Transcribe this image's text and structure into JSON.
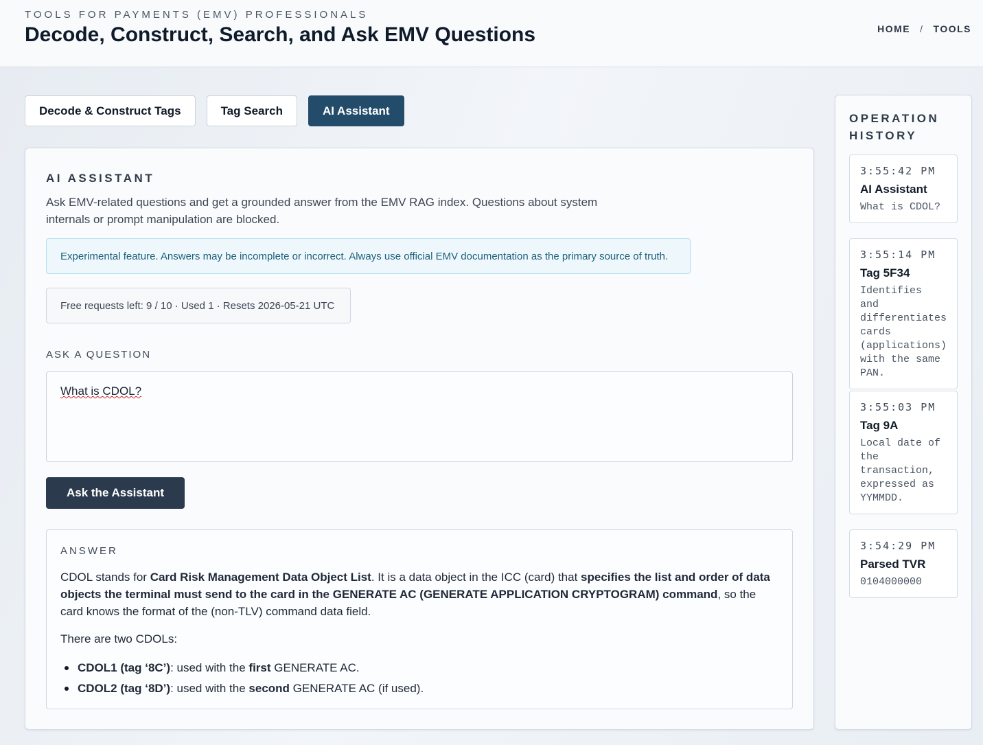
{
  "header": {
    "eyebrow": "TOOLS FOR PAYMENTS (EMV) PROFESSIONALS",
    "title": "Decode, Construct, Search, and Ask EMV Questions",
    "nav": [
      {
        "label": "HOME"
      },
      {
        "label": "TOOLS"
      }
    ],
    "nav_separator": "/"
  },
  "tabs": [
    {
      "label": "Decode & Construct Tags",
      "active": false
    },
    {
      "label": "Tag Search",
      "active": false
    },
    {
      "label": "AI Assistant",
      "active": true
    }
  ],
  "assistant": {
    "section_title": "AI ASSISTANT",
    "description": "Ask EMV-related questions and get a grounded answer from the EMV RAG index. Questions about system internals or prompt manipulation are blocked.",
    "notice": "Experimental feature. Answers may be incomplete or incorrect. Always use official EMV documentation as the primary source of truth.",
    "quota": "Free requests left: 9 / 10 · Used 1 · Resets 2026-05-21 UTC",
    "question_label": "ASK A QUESTION",
    "question_value": "What is CDOL?",
    "ask_button": "Ask the Assistant",
    "answer_label": "ANSWER",
    "answer": {
      "p1_a": "CDOL stands for ",
      "p1_b": "Card Risk Management Data Object List",
      "p1_c": ". It is a data object in the ICC (card) that ",
      "p1_d": "specifies the list and order of data objects the terminal must send to the card in the GENERATE AC (GENERATE APPLICATION CRYPTOGRAM) command",
      "p1_e": ", so the card knows the format of the (non-TLV) command data field.",
      "p2": "There are two CDOLs:",
      "items": [
        {
          "term": "CDOL1 (tag ‘8C’)",
          "pre": ": used with the ",
          "bold": "first",
          "post": " GENERATE AC."
        },
        {
          "term": "CDOL2 (tag ‘8D’)",
          "pre": ": used with the ",
          "bold": "second",
          "post": " GENERATE AC (if used)."
        }
      ]
    }
  },
  "history": {
    "title": "OPERATION HISTORY",
    "items": [
      {
        "time": "3:55:42 PM",
        "name": "AI Assistant",
        "detail": "What is CDOL?"
      },
      {
        "time": "3:55:14 PM",
        "name": "Tag 5F34",
        "detail": "Identifies and differentiates cards (applications) with the same PAN."
      },
      {
        "time": "3:55:03 PM",
        "name": "Tag 9A",
        "detail": "Local date of the transaction, expressed as YYMMDD."
      },
      {
        "time": "3:54:29 PM",
        "name": "Parsed TVR",
        "detail": "0104000000"
      }
    ]
  }
}
